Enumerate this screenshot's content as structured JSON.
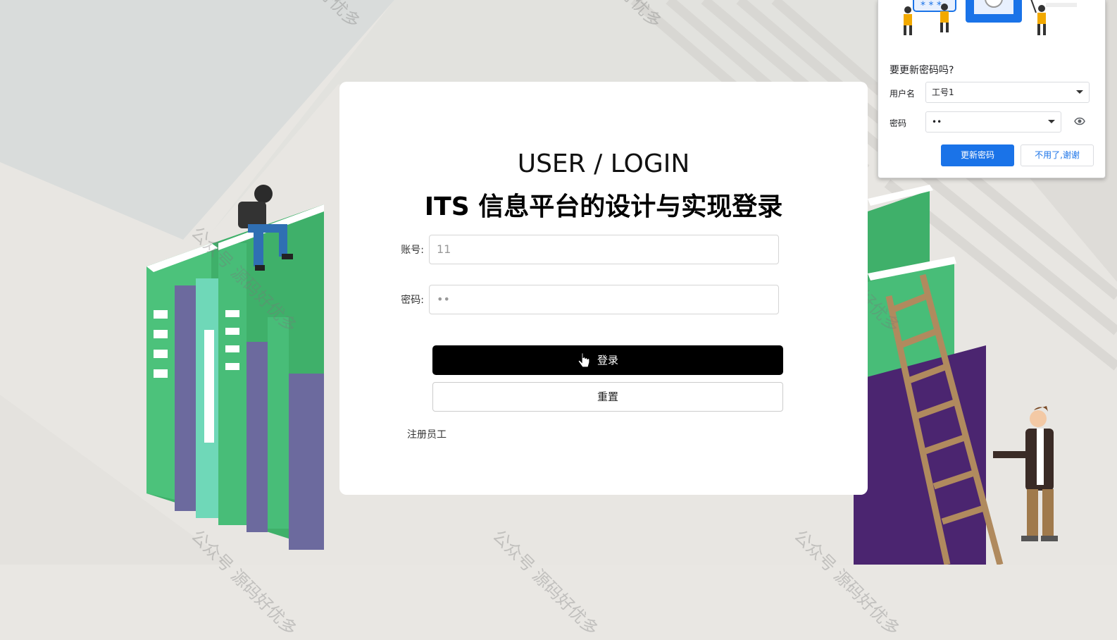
{
  "login": {
    "title_en": "USER / LOGIN",
    "title_cn": "ITS 信息平台的设计与实现登录",
    "account_label": "账号:",
    "account_value": "11",
    "password_label": "密码:",
    "password_value": "••",
    "login_button": "登录",
    "reset_button": "重置",
    "register_link": "注册员工"
  },
  "password_popup": {
    "title": "要更新密码吗?",
    "username_label": "用户名",
    "username_value": "工号1",
    "password_label": "密码",
    "password_value": "••",
    "update_button": "更新密码",
    "dismiss_button": "不用了,谢谢"
  },
  "watermark": {
    "text": "公众号 源码好优多"
  },
  "colors": {
    "primary_button": "#000000",
    "popup_primary": "#1a73e8",
    "book_green": "#45b86f",
    "book_purple": "#6a6b9e",
    "book_dark_purple": "#4b2570"
  }
}
